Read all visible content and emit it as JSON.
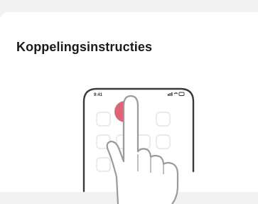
{
  "sheet": {
    "title": "Koppelingsinstructies"
  },
  "illustration": {
    "phone": {
      "status_time": "9:41"
    },
    "colors": {
      "tap_indicator": "#e06478",
      "outline": "#3a3a3a",
      "hand_outline": "#9a9a9a",
      "app_icon": "#e6e6e6"
    },
    "icons": [
      "phone-outline-icon",
      "tap-indicator-icon",
      "hand-icon",
      "signal-icon",
      "wifi-icon",
      "battery-icon"
    ]
  }
}
